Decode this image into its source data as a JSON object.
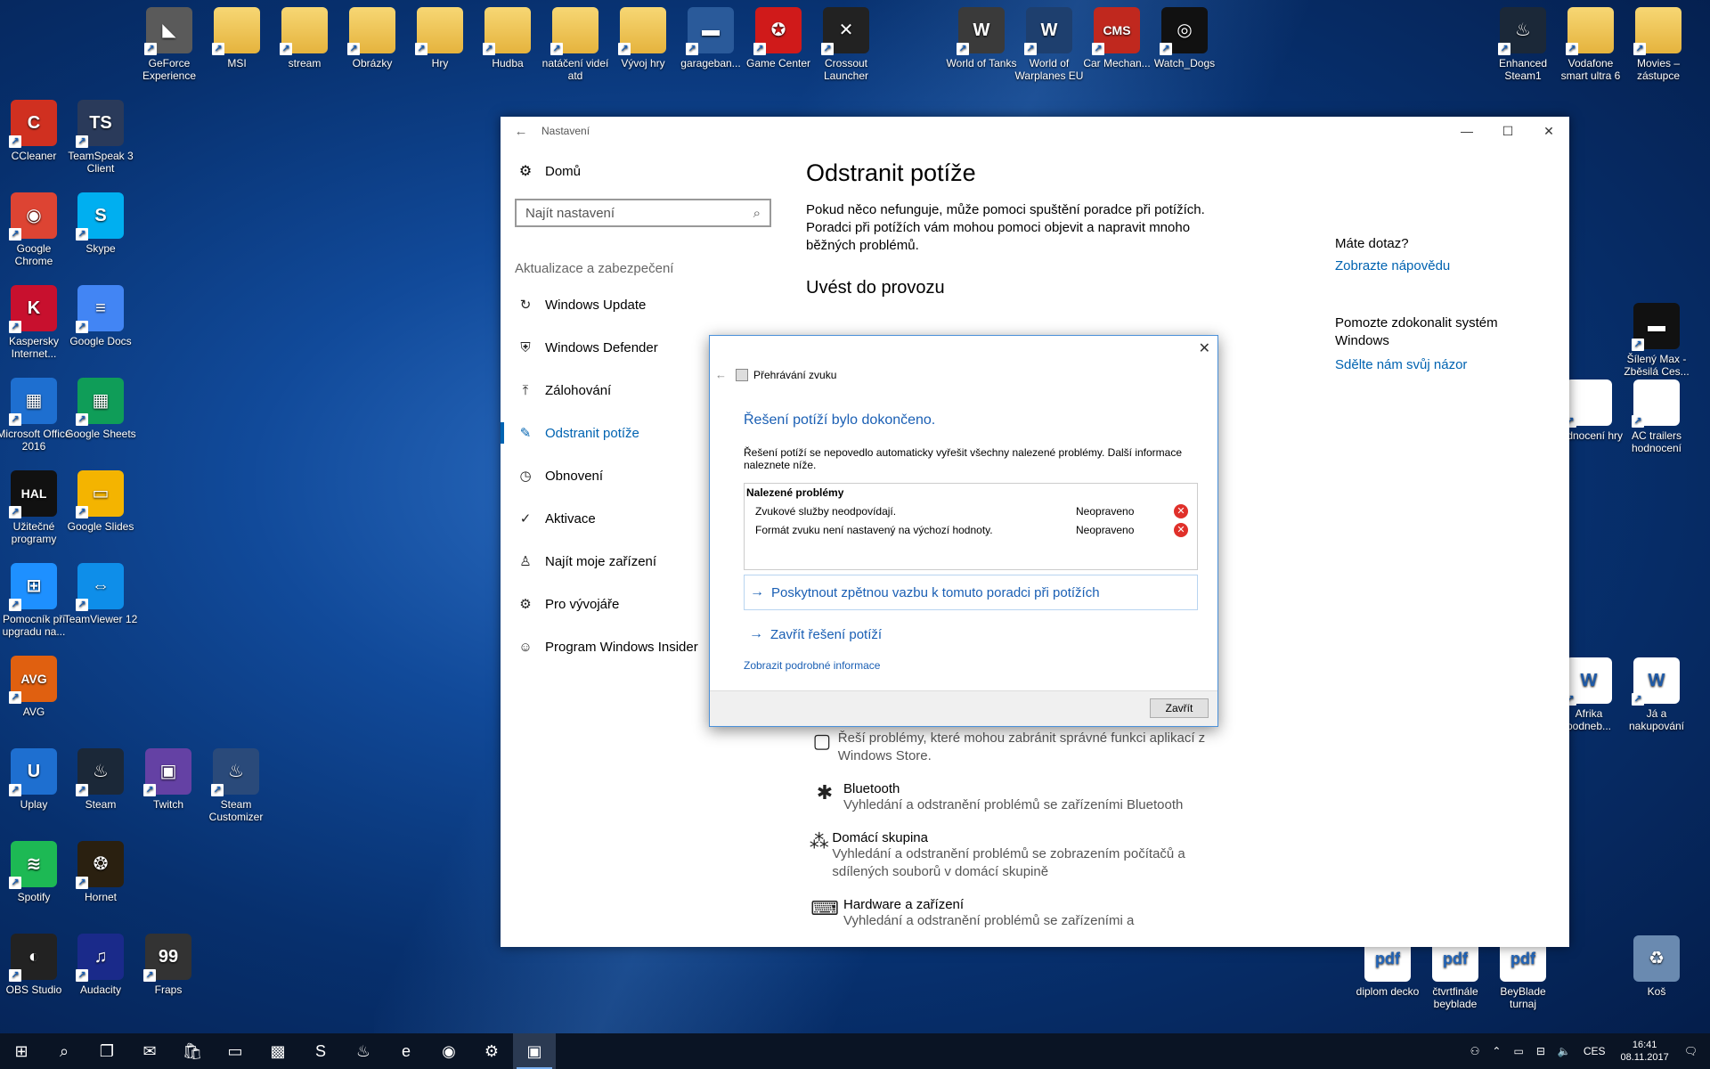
{
  "desktop": {
    "top_row": [
      {
        "label": "GeForce Experience",
        "glyph": "◣",
        "color": "#5a5a5a"
      },
      {
        "label": "MSI",
        "glyph": "",
        "color": "folder"
      },
      {
        "label": "stream",
        "glyph": "",
        "color": "folder"
      },
      {
        "label": "Obrázky",
        "glyph": "",
        "color": "folder"
      },
      {
        "label": "Hry",
        "glyph": "",
        "color": "folder"
      },
      {
        "label": "Hudba",
        "glyph": "",
        "color": "folder"
      },
      {
        "label": "natáčení videí atd",
        "glyph": "",
        "color": "folder"
      },
      {
        "label": "Vývoj hry",
        "glyph": "",
        "color": "folder"
      },
      {
        "label": "garageban...",
        "glyph": "▬",
        "color": "#2a5a9a"
      },
      {
        "label": "Game Center",
        "glyph": "✪",
        "color": "#d01a1a"
      },
      {
        "label": "Crossout Launcher",
        "glyph": "✕",
        "color": "#222222"
      }
    ],
    "top_row2": [
      {
        "label": "World of Tanks",
        "glyph": "W",
        "color": "#3a3a3a"
      },
      {
        "label": "World of Warplanes EU",
        "glyph": "W",
        "color": "#1e3f6e"
      },
      {
        "label": "Car Mechan...",
        "glyph": "CMS",
        "color": "#c0281e"
      },
      {
        "label": "Watch_Dogs",
        "glyph": "◎",
        "color": "#111111"
      }
    ],
    "top_right": [
      {
        "label": "Enhanced Steam1",
        "glyph": "♨",
        "color": "#1b2838"
      },
      {
        "label": "Vodafone smart ultra 6",
        "glyph": "",
        "color": "folder"
      },
      {
        "label": "Movies – zástupce",
        "glyph": "",
        "color": "folder"
      }
    ],
    "left_col1": [
      {
        "label": "CCleaner",
        "glyph": "C",
        "color": "#d03020"
      },
      {
        "label": "Google Chrome",
        "glyph": "◉",
        "color": "#dd4433"
      },
      {
        "label": "Kaspersky Internet...",
        "glyph": "K",
        "color": "#c8102e"
      },
      {
        "label": "Microsoft Office 2016",
        "glyph": "▦",
        "color": "#1e6fd0"
      },
      {
        "label": "Užitečné programy",
        "glyph": "HAL",
        "color": "#111111"
      },
      {
        "label": "Pomocník při upgradu na...",
        "glyph": "⊞",
        "color": "#1e90ff"
      },
      {
        "label": "AVG",
        "glyph": "AVG",
        "color": "#e06010"
      },
      {
        "label": "Uplay",
        "glyph": "U",
        "color": "#1e6fd0"
      },
      {
        "label": "Spotify",
        "glyph": "≋",
        "color": "#1db954"
      },
      {
        "label": "OBS Studio",
        "glyph": "◐",
        "color": "#222222"
      }
    ],
    "left_col2": [
      {
        "label": "TeamSpeak 3 Client",
        "glyph": "TS",
        "color": "#2a3a5a"
      },
      {
        "label": "Skype",
        "glyph": "S",
        "color": "#00aff0"
      },
      {
        "label": "Google Docs",
        "glyph": "≡",
        "color": "#4285f4"
      },
      {
        "label": "Google Sheets",
        "glyph": "▦",
        "color": "#0f9d58"
      },
      {
        "label": "Google Slides",
        "glyph": "▭",
        "color": "#f4b400"
      },
      {
        "label": "TeamViewer 12",
        "glyph": "⇔",
        "color": "#0e8ee9"
      },
      {
        "label": "Steam",
        "glyph": "♨",
        "color": "#1b2838"
      },
      {
        "label": "Hornet",
        "glyph": "❂",
        "color": "#2a2010"
      },
      {
        "label": "Audacity",
        "glyph": "♫",
        "color": "#1a2a8a"
      }
    ],
    "left_col3": [
      {
        "label": "Twitch",
        "glyph": "▣",
        "color": "#6441a4"
      },
      {
        "label": "Fraps",
        "glyph": "99",
        "color": "#333333"
      }
    ],
    "left_col4": [
      {
        "label": "Steam Customizer",
        "glyph": "♨",
        "color": "#2a4a7a"
      }
    ],
    "right_col": [
      {
        "label": "Šílený Max - Zběsilá Ces...",
        "glyph": "▬",
        "color": "#111111"
      },
      {
        "label": "AC trailers hodnocení",
        "glyph": "",
        "color": "doc"
      },
      {
        "label": "Já a nakupování",
        "glyph": "W",
        "color": "doc"
      }
    ],
    "right_col_partial": [
      {
        "label": "hodnocení hry",
        "glyph": "",
        "color": "doc"
      },
      {
        "label": "Afrika podneb...",
        "glyph": "W",
        "color": "doc"
      }
    ],
    "bottom_right": [
      {
        "label": "diplom decko",
        "glyph": "pdf",
        "color": "pdf"
      },
      {
        "label": "čtvrtfinále beyblade",
        "glyph": "pdf",
        "color": "pdf"
      },
      {
        "label": "BeyBlade turnaj",
        "glyph": "pdf",
        "color": "pdf"
      },
      {
        "label": "Koš",
        "glyph": "♻",
        "color": "#6a8ab0"
      }
    ]
  },
  "settings": {
    "window_title": "Nastavení",
    "home_label": "Domů",
    "search_placeholder": "Najít nastavení",
    "section_label": "Aktualizace a zabezpečení",
    "nav_items": [
      {
        "label": "Windows Update",
        "icon": "↻"
      },
      {
        "label": "Windows Defender",
        "icon": "⛨"
      },
      {
        "label": "Zálohování",
        "icon": "⤒"
      },
      {
        "label": "Odstranit potíže",
        "icon": "✎"
      },
      {
        "label": "Obnovení",
        "icon": "◷"
      },
      {
        "label": "Aktivace",
        "icon": "✓"
      },
      {
        "label": "Najít moje zařízení",
        "icon": "♙"
      },
      {
        "label": "Pro vývojáře",
        "icon": "⚙"
      },
      {
        "label": "Program Windows Insider",
        "icon": "☺"
      }
    ],
    "main": {
      "title": "Odstranit potíže",
      "intro": "Pokud něco nefunguje, může pomoci spuštění poradce při potížích. Poradci při potížích vám mohou pomoci objevit a napravit mnoho běžných problémů.",
      "section_title": "Uvést do provozu",
      "list": [
        {
          "title": "",
          "desc": "Řeší problémy, které mohou zabránit správné funkci aplikací z Windows Store.",
          "icon": "▢"
        },
        {
          "title": "Bluetooth",
          "desc": "Vyhledání a odstranění problémů se zařízeními Bluetooth",
          "icon": "✱"
        },
        {
          "title": "Domácí skupina",
          "desc": "Vyhledání a odstranění problémů se zobrazením počítačů a sdílených souborů v domácí skupině",
          "icon": "⁂"
        },
        {
          "title": "Hardware a zařízení",
          "desc": "Vyhledání a odstranění problémů se zařízeními a",
          "icon": "⌨"
        }
      ]
    },
    "side": {
      "question": "Máte dotaz?",
      "help_link": "Zobrazte nápovědu",
      "improve": "Pomozte zdokonalit systém Windows",
      "feedback_link": "Sdělte nám svůj názor"
    }
  },
  "dialog": {
    "app_title": "Přehrávání zvuku",
    "heading": "Řešení potíží bylo dokončeno.",
    "message": "Řešení potíží se nepovedlo automaticky vyřešit všechny nalezené problémy. Další informace naleznete níže.",
    "problems_header": "Nalezené problémy",
    "problems": [
      {
        "name": "Zvukové služby neodpovídají.",
        "status": "Neopraveno"
      },
      {
        "name": "Formát zvuku není nastavený na výchozí hodnoty.",
        "status": "Neopraveno"
      }
    ],
    "feedback_link": "Poskytnout zpětnou vazbu k tomuto poradci při potížích",
    "close_troubleshoot": "Zavřít řešení potíží",
    "details_link": "Zobrazit podrobné informace",
    "close_button": "Zavřít"
  },
  "taskbar": {
    "items": [
      {
        "name": "start",
        "glyph": "⊞"
      },
      {
        "name": "search",
        "glyph": "⌕"
      },
      {
        "name": "task-view",
        "glyph": "❐"
      },
      {
        "name": "mail",
        "glyph": "✉"
      },
      {
        "name": "store",
        "glyph": "🛍"
      },
      {
        "name": "explorer",
        "glyph": "▭"
      },
      {
        "name": "minecraft",
        "glyph": "▩"
      },
      {
        "name": "skype",
        "glyph": "S"
      },
      {
        "name": "steam",
        "glyph": "♨"
      },
      {
        "name": "edge",
        "glyph": "e"
      },
      {
        "name": "chrome",
        "glyph": "◉"
      },
      {
        "name": "settings",
        "glyph": "⚙"
      },
      {
        "name": "troubleshooter",
        "glyph": "▣"
      }
    ],
    "language": "CES",
    "time": "16:41",
    "date": "08.11.2017"
  }
}
